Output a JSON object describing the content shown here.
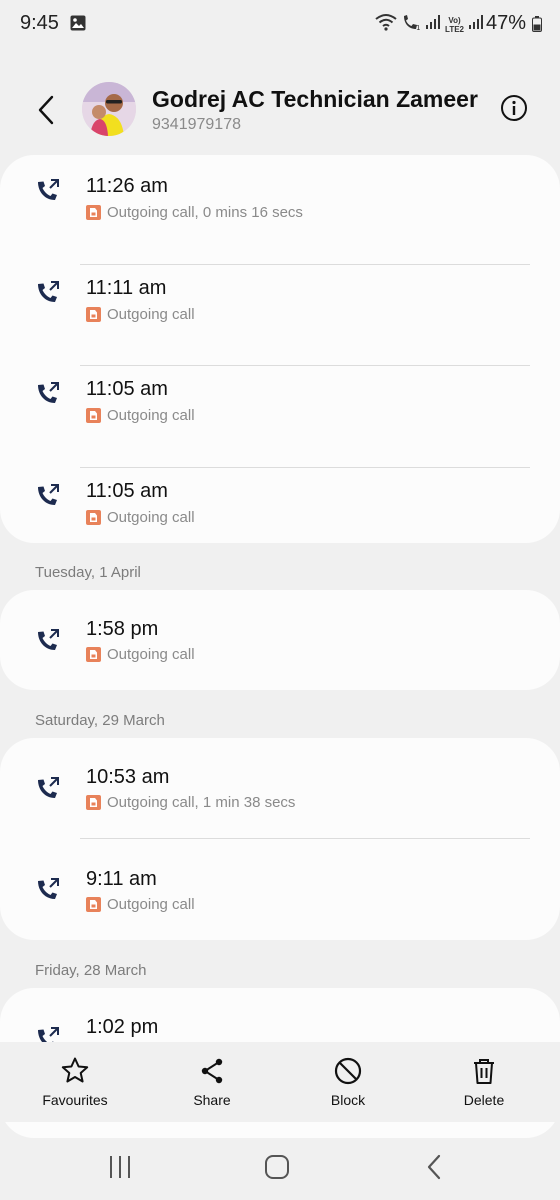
{
  "status_bar": {
    "time": "9:45",
    "battery": "47%",
    "icons": [
      "gallery-icon",
      "wifi-icon",
      "wifi-call-icon",
      "signal-icon",
      "volte-icon",
      "signal-icon",
      "battery-icon"
    ],
    "volte_line1": "Vo)",
    "volte_line2": "LTE2"
  },
  "header": {
    "contact_name": "Godrej AC Technician Zameer",
    "contact_number": "9341979178"
  },
  "groups": [
    {
      "date": "",
      "calls": [
        {
          "time": "11:26 am",
          "detail": "Outgoing call, 0 mins 16 secs"
        },
        {
          "time": "11:11 am",
          "detail": "Outgoing call"
        },
        {
          "time": "11:05 am",
          "detail": "Outgoing call"
        },
        {
          "time": "11:05 am",
          "detail": "Outgoing call"
        }
      ]
    },
    {
      "date": "Tuesday, 1 April",
      "calls": [
        {
          "time": "1:58 pm",
          "detail": "Outgoing call"
        }
      ]
    },
    {
      "date": "Saturday, 29 March",
      "calls": [
        {
          "time": "10:53 am",
          "detail": "Outgoing call, 1 min 38 secs"
        },
        {
          "time": "9:11 am",
          "detail": "Outgoing call"
        }
      ]
    },
    {
      "date": "Friday, 28 March",
      "calls": [
        {
          "time": "1:02 pm",
          "detail": ""
        }
      ]
    }
  ],
  "actions": {
    "favourites": "Favourites",
    "share": "Share",
    "block": "Block",
    "delete": "Delete"
  },
  "colors": {
    "call_icon": "#1d2b4f",
    "sim_badge": "#e8825a",
    "background": "#f0f0f0",
    "card": "#fcfcfc"
  }
}
